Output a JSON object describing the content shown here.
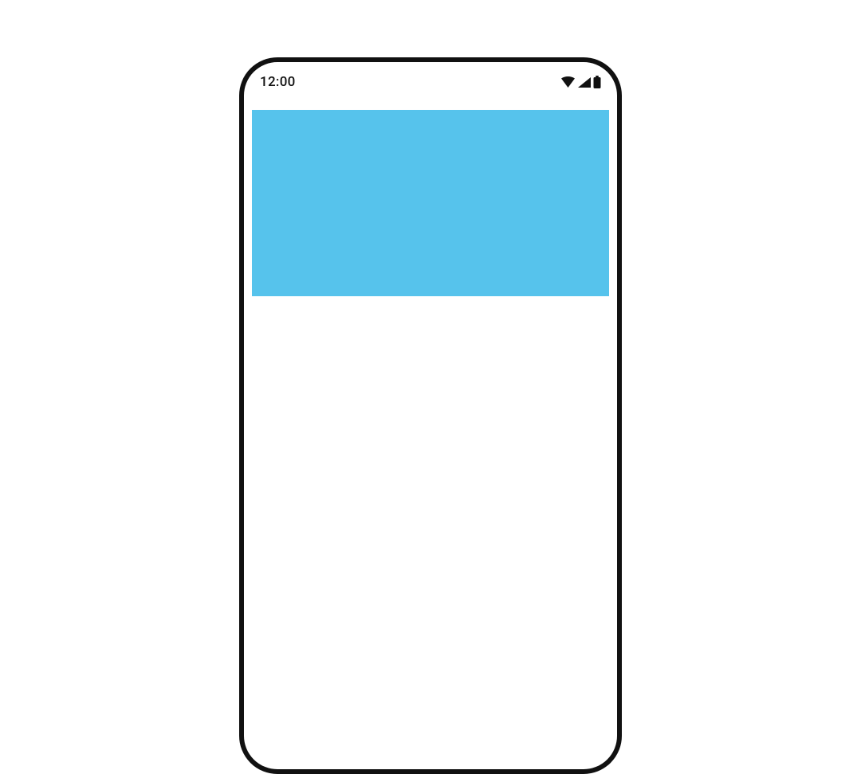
{
  "status_bar": {
    "time": "12:00",
    "icons": {
      "wifi": "wifi-icon",
      "signal": "cellular-signal-icon",
      "battery": "battery-icon"
    }
  },
  "content": {
    "banner_color": "#56c3ec"
  }
}
